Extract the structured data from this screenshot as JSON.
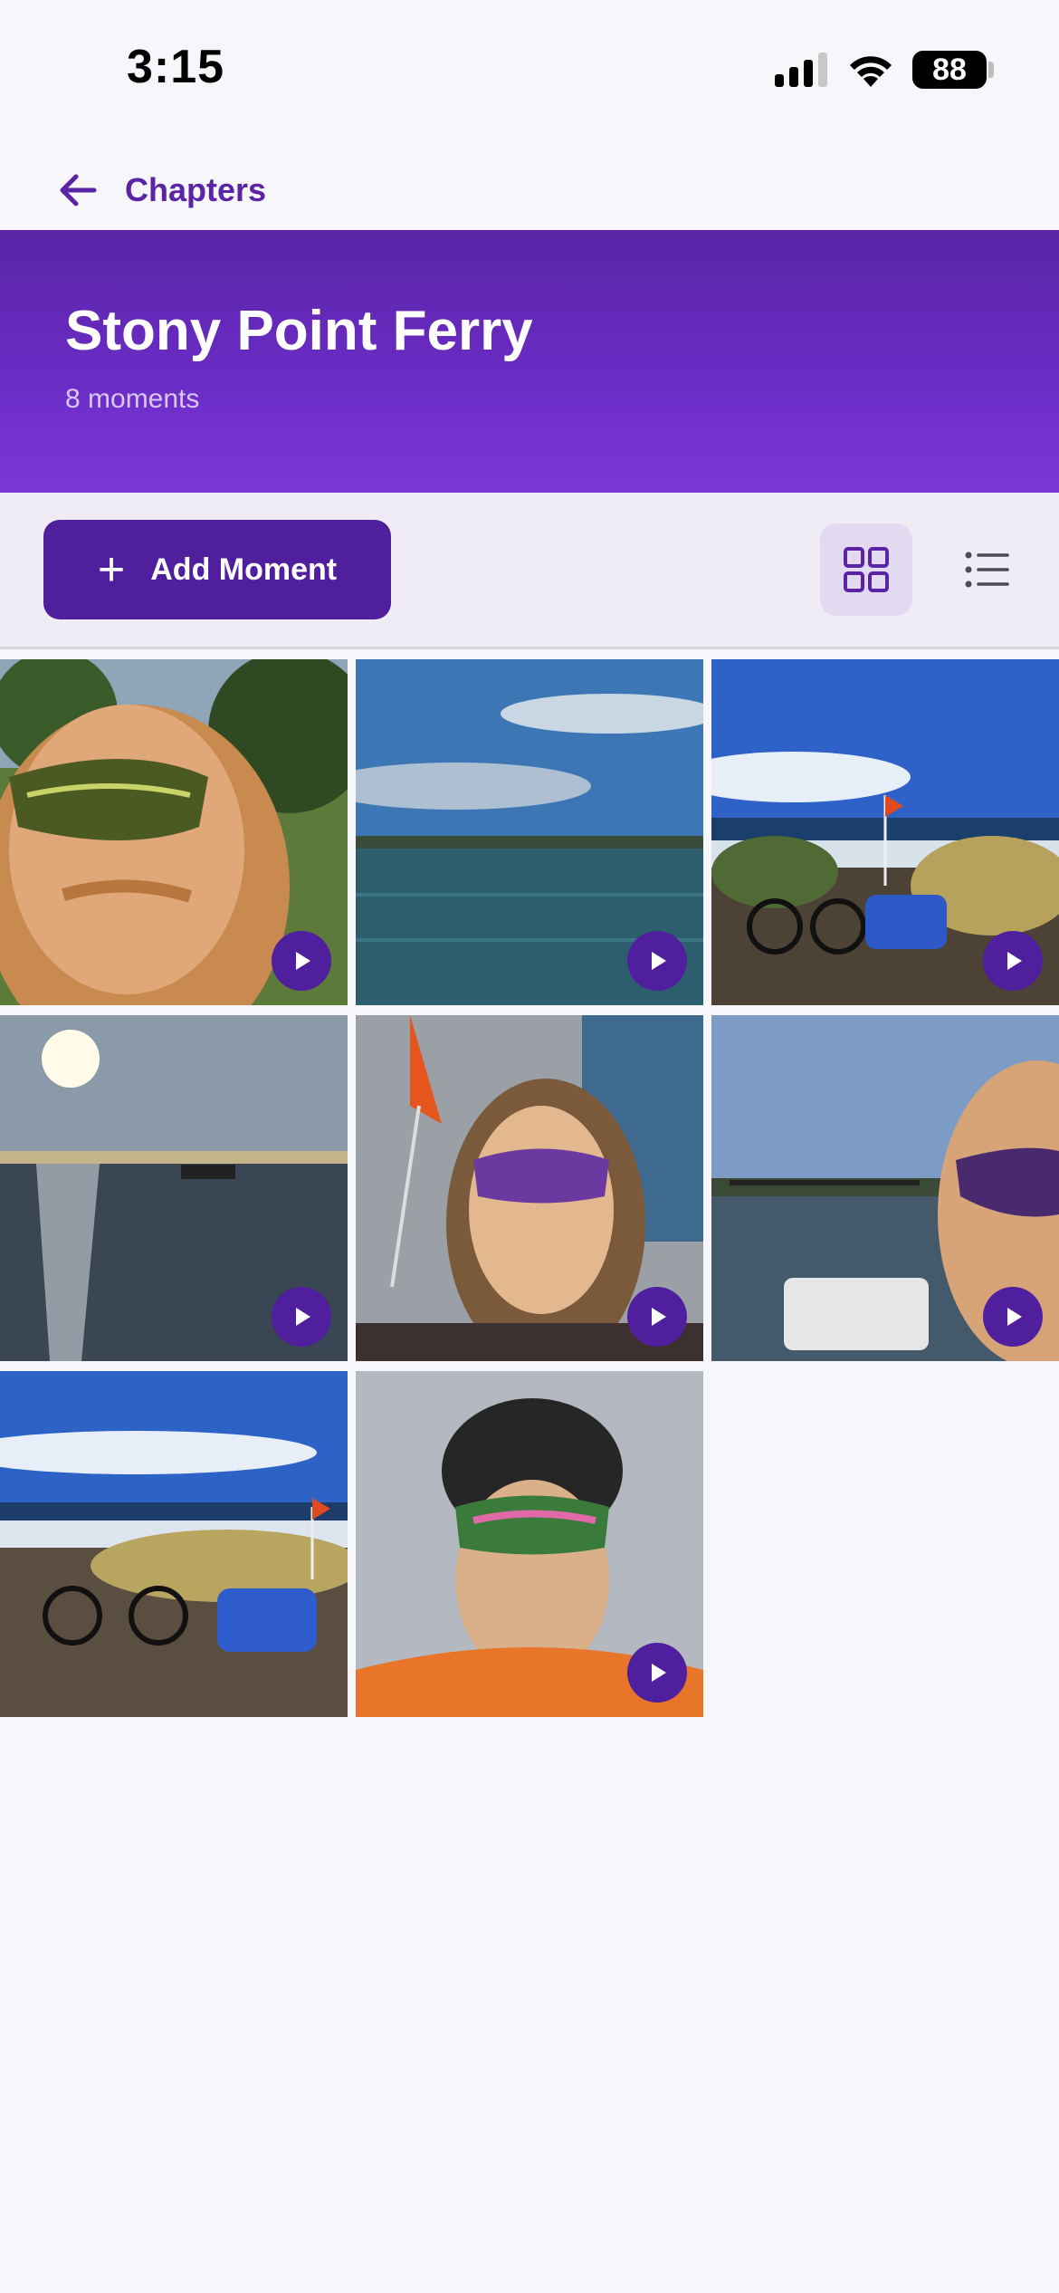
{
  "status": {
    "time": "3:15",
    "battery": "88"
  },
  "nav": {
    "back_label": "Chapters"
  },
  "header": {
    "title": "Stony Point Ferry",
    "subtitle": "8 moments"
  },
  "toolbar": {
    "add_label": "Add Moment",
    "view_modes": [
      "grid",
      "list"
    ],
    "selected_view": "grid"
  },
  "colors": {
    "accent": "#4f1f9e",
    "header_top": "#5a24a6",
    "header_bottom": "#7d36d8",
    "background": "#f7f6fa"
  },
  "moments": [
    {
      "id": "m1",
      "kind": "video",
      "scene": "selfie-sunglasses-trees"
    },
    {
      "id": "m2",
      "kind": "video",
      "scene": "bay-water-clouds"
    },
    {
      "id": "m3",
      "kind": "video",
      "scene": "beach-bike-trailer"
    },
    {
      "id": "m4",
      "kind": "video",
      "scene": "sunset-ferry-water"
    },
    {
      "id": "m5",
      "kind": "video",
      "scene": "ferry-selfie-flag"
    },
    {
      "id": "m6",
      "kind": "video",
      "scene": "ferry-pier-selfie"
    },
    {
      "id": "m7",
      "kind": "video",
      "scene": "beach-bike-trailer"
    },
    {
      "id": "m8",
      "kind": "video",
      "scene": "helmet-selfie-orange"
    }
  ]
}
